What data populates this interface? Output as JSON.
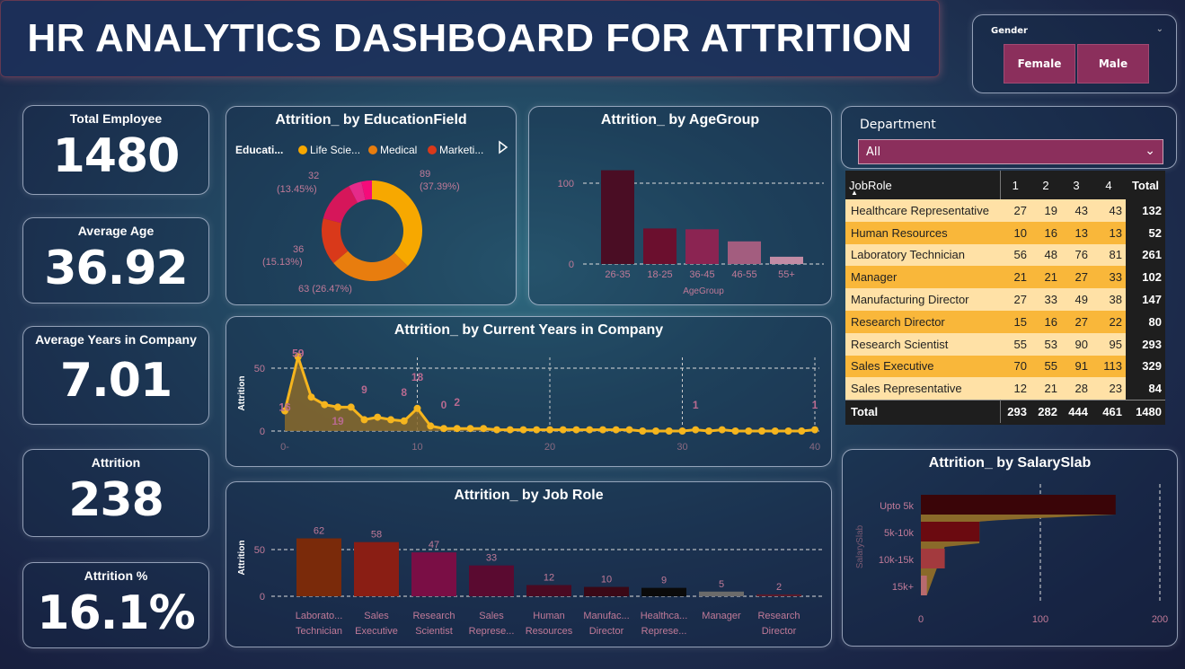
{
  "title": "HR ANALYTICS DASHBOARD FOR ATTRITION",
  "gender": {
    "label": "Gender",
    "options": [
      "Female",
      "Male"
    ]
  },
  "kpis": [
    {
      "label": "Total Employee",
      "value": "1480"
    },
    {
      "label": "Average Age",
      "value": "36.92"
    },
    {
      "label": "Average Years in Company",
      "value": "7.01"
    },
    {
      "label": "Attrition",
      "value": "238"
    },
    {
      "label": "Attrition %",
      "value": "16.1%"
    }
  ],
  "education": {
    "title": "Attrition_ by EducationField",
    "legend_title": "Educati...",
    "legend": [
      "Life Scie...",
      "Medical",
      "Marketi..."
    ],
    "slices": [
      {
        "value": 89,
        "label": "89",
        "pct": "(37.39%)",
        "color": "#f7a800"
      },
      {
        "value": 63,
        "label": "63 (26.47%)",
        "pct": "",
        "color": "#e87d0e"
      },
      {
        "value": 36,
        "label": "36",
        "pct": "(15.13%)",
        "color": "#d9391a"
      },
      {
        "value": 32,
        "label": "32",
        "pct": "(13.45%)",
        "color": "#d6165a"
      },
      {
        "value": 10,
        "label": "",
        "pct": "",
        "color": "#e52a8a"
      },
      {
        "value": 8,
        "label": "",
        "pct": "",
        "color": "#f50b7a"
      }
    ]
  },
  "agegroup": {
    "title": "Attrition_ by AgeGroup",
    "xlabel": "AgeGroup",
    "ticks": [
      "100",
      "0"
    ],
    "categories": [
      "26-35",
      "18-25",
      "36-45",
      "46-55",
      "55+"
    ],
    "values": [
      116,
      44,
      43,
      28,
      9
    ],
    "colors": [
      "#4a0d24",
      "#6b0f2e",
      "#8b2452",
      "#a35d7f",
      "#c28ca5"
    ]
  },
  "years": {
    "title": "Attrition_ by Current Years in Company",
    "ylabel": "Attrition",
    "yticks": [
      "50",
      "0"
    ],
    "xticks": [
      "0-",
      "10",
      "20",
      "30",
      "40"
    ],
    "x": [
      0,
      1,
      2,
      3,
      4,
      5,
      6,
      7,
      8,
      9,
      10,
      11,
      12,
      13,
      14,
      15,
      16,
      17,
      18,
      19,
      20,
      21,
      22,
      23,
      24,
      25,
      26,
      27,
      28,
      29,
      30,
      31,
      32,
      33,
      34,
      35,
      36,
      37,
      38,
      39,
      40
    ],
    "y": [
      16,
      59,
      27,
      21,
      19,
      19,
      9,
      11,
      9,
      8,
      18,
      4,
      2,
      2,
      2,
      2,
      1,
      1,
      1,
      1,
      1,
      1,
      1,
      1,
      1,
      1,
      1,
      0,
      0,
      0,
      0,
      1,
      0,
      1,
      0,
      0,
      0,
      0,
      0,
      0,
      1
    ],
    "labels": [
      {
        "text": "16",
        "x": 0,
        "y": 16
      },
      {
        "text": "59",
        "x": 1,
        "y": 59
      },
      {
        "text": "19",
        "x": 4,
        "y": 5
      },
      {
        "text": "9",
        "x": 6,
        "y": 30
      },
      {
        "text": "8",
        "x": 9,
        "y": 28
      },
      {
        "text": "18",
        "x": 10,
        "y": 40
      },
      {
        "text": "0",
        "x": 12,
        "y": 18
      },
      {
        "text": "2",
        "x": 13,
        "y": 20
      },
      {
        "text": "1",
        "x": 31,
        "y": 18
      },
      {
        "text": "1",
        "x": 40,
        "y": 18
      }
    ]
  },
  "jobrole": {
    "title": "Attrition_ by Job Role",
    "ylabel": "Attrition",
    "yticks": [
      "50",
      "0"
    ],
    "categories": [
      [
        "Laborato...",
        "Technician"
      ],
      [
        "Sales",
        "Executive"
      ],
      [
        "Research",
        "Scientist"
      ],
      [
        "Sales",
        "Represe..."
      ],
      [
        "Human",
        "Resources"
      ],
      [
        "Manufac...",
        "Director"
      ],
      [
        "Healthca...",
        "Represe..."
      ],
      [
        "Manager",
        ""
      ],
      [
        "Research",
        "Director"
      ]
    ],
    "values": [
      62,
      58,
      47,
      33,
      12,
      10,
      9,
      5,
      2
    ],
    "labels": [
      "62",
      "58",
      "47",
      "33",
      "12",
      "10",
      "9",
      "5",
      "2"
    ],
    "colors": [
      "#7a2a0a",
      "#8a1e14",
      "#7a0e45",
      "#5a0a30",
      "#4a0a22",
      "#3a0816",
      "#0a0a0a",
      "#6b6b6b",
      "#5a1a2a"
    ]
  },
  "department": {
    "label": "Department",
    "value": "All"
  },
  "matrix": {
    "headers": [
      "JobRole",
      "1",
      "2",
      "3",
      "4",
      "Total"
    ],
    "rows": [
      [
        "Healthcare Representative",
        "27",
        "19",
        "43",
        "43",
        "132"
      ],
      [
        "Human Resources",
        "10",
        "16",
        "13",
        "13",
        "52"
      ],
      [
        "Laboratory Technician",
        "56",
        "48",
        "76",
        "81",
        "261"
      ],
      [
        "Manager",
        "21",
        "21",
        "27",
        "33",
        "102"
      ],
      [
        "Manufacturing Director",
        "27",
        "33",
        "49",
        "38",
        "147"
      ],
      [
        "Research Director",
        "15",
        "16",
        "27",
        "22",
        "80"
      ],
      [
        "Research Scientist",
        "55",
        "53",
        "90",
        "95",
        "293"
      ],
      [
        "Sales Executive",
        "70",
        "55",
        "91",
        "113",
        "329"
      ],
      [
        "Sales Representative",
        "12",
        "21",
        "28",
        "23",
        "84"
      ]
    ],
    "total": [
      "Total",
      "293",
      "282",
      "444",
      "461",
      "1480"
    ]
  },
  "salary": {
    "title": "Attrition_ by SalarySlab",
    "ylabel": "SalarySlab",
    "categories": [
      "Upto 5k",
      "5k-10k",
      "10k-15k",
      "15k+"
    ],
    "values": [
      163,
      49,
      20,
      5
    ],
    "xticks": [
      "0",
      "100",
      "200"
    ],
    "colors": [
      "#3a0508",
      "#6b0a10",
      "#a33a3e",
      "#b86a6e"
    ],
    "area_color": "#8a6a2a"
  }
}
